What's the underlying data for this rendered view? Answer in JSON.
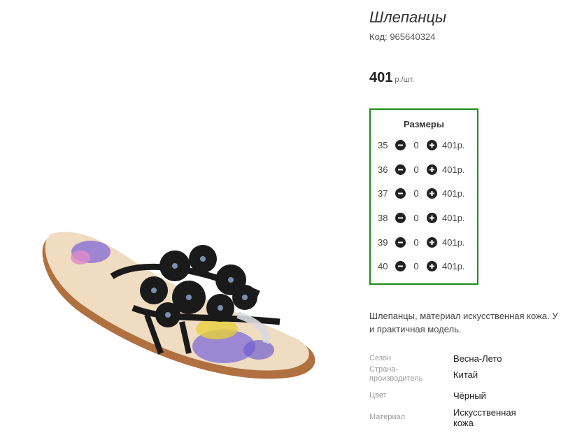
{
  "product": {
    "title": "Шлепанцы",
    "code": "Код: 965640324",
    "price": "401",
    "price_unit": "р./шт."
  },
  "sizes": {
    "heading": "Размеры",
    "rows": [
      {
        "size": "35",
        "qty": "0",
        "price": "401р."
      },
      {
        "size": "36",
        "qty": "0",
        "price": "401р."
      },
      {
        "size": "37",
        "qty": "0",
        "price": "401р."
      },
      {
        "size": "38",
        "qty": "0",
        "price": "401р."
      },
      {
        "size": "39",
        "qty": "0",
        "price": "401р."
      },
      {
        "size": "40",
        "qty": "0",
        "price": "401р."
      }
    ]
  },
  "description": {
    "line1": "Шлепанцы, материал искусственная кожа. У",
    "line2": "и практичная модель."
  },
  "attributes": [
    {
      "label": "Сезон",
      "value": "Весна-Лето"
    },
    {
      "label": "Страна-\nпроизводитель",
      "value": "Китай"
    },
    {
      "label": "Цвет",
      "value": "Чёрный"
    },
    {
      "label": "Материал",
      "value": "Искусственная\nкожа"
    }
  ],
  "icons": {
    "minus": "minus-circle-icon",
    "plus": "plus-circle-icon"
  },
  "colors": {
    "sizes_border": "#1a8a1a",
    "button": "#222222"
  }
}
